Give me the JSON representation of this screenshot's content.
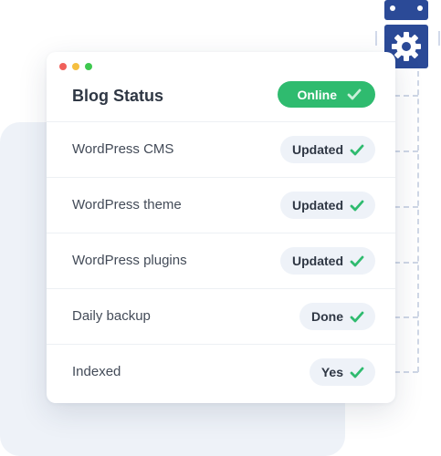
{
  "window": {
    "title": "Blog Status",
    "status_label": "Online",
    "status_color": "#2fbb6f"
  },
  "checks": [
    {
      "label": "WordPress CMS",
      "status": "Updated"
    },
    {
      "label": "WordPress theme",
      "status": "Updated"
    },
    {
      "label": "WordPress plugins",
      "status": "Updated"
    },
    {
      "label": "Daily backup",
      "status": "Done"
    },
    {
      "label": "Indexed",
      "status": "Yes"
    }
  ],
  "icons": {
    "check": "check-icon",
    "robot": "robot-gear-icon"
  },
  "colors": {
    "accent_green": "#2fbb6f",
    "badge_bg": "#eef2f8",
    "robot_blue": "#2b4a97"
  }
}
